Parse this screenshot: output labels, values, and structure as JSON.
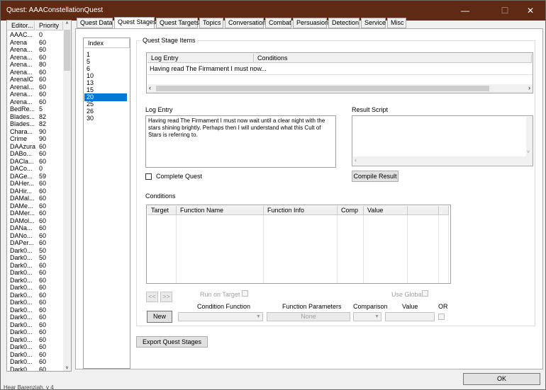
{
  "window": {
    "title": "Quest: AAAConstellationQuest",
    "ok_label": "OK"
  },
  "left_list": {
    "headers": [
      "Editor...",
      "Priority"
    ],
    "rows": [
      [
        "AAAC...",
        "0"
      ],
      [
        "Arena",
        "60"
      ],
      [
        "Arena...",
        "60"
      ],
      [
        "Arena...",
        "60"
      ],
      [
        "Arena...",
        "80"
      ],
      [
        "Arena...",
        "60"
      ],
      [
        "ArenaIC",
        "60"
      ],
      [
        "ArenaI...",
        "60"
      ],
      [
        "Arena...",
        "60"
      ],
      [
        "Arena...",
        "60"
      ],
      [
        "BedRe...",
        "5"
      ],
      [
        "Blades...",
        "82"
      ],
      [
        "Blades...",
        "82"
      ],
      [
        "Chara...",
        "90"
      ],
      [
        "Crime",
        "90"
      ],
      [
        "DAAzura",
        "60"
      ],
      [
        "DABo...",
        "60"
      ],
      [
        "DACla...",
        "60"
      ],
      [
        "DACo...",
        "0"
      ],
      [
        "DAGe...",
        "59"
      ],
      [
        "DAHer...",
        "60"
      ],
      [
        "DAHir...",
        "60"
      ],
      [
        "DAMal...",
        "60"
      ],
      [
        "DAMe...",
        "60"
      ],
      [
        "DAMer...",
        "60"
      ],
      [
        "DAMol...",
        "60"
      ],
      [
        "DANa...",
        "60"
      ],
      [
        "DANo...",
        "60"
      ],
      [
        "DAPer...",
        "60"
      ],
      [
        "Dark0...",
        "50"
      ],
      [
        "Dark0...",
        "50"
      ],
      [
        "Dark0...",
        "60"
      ],
      [
        "Dark0...",
        "60"
      ],
      [
        "Dark0...",
        "60"
      ],
      [
        "Dark0...",
        "60"
      ],
      [
        "Dark0...",
        "60"
      ],
      [
        "Dark0...",
        "60"
      ],
      [
        "Dark0...",
        "60"
      ],
      [
        "Dark0...",
        "60"
      ],
      [
        "Dark0...",
        "60"
      ],
      [
        "Dark0...",
        "60"
      ],
      [
        "Dark0...",
        "60"
      ],
      [
        "Dark0...",
        "60"
      ],
      [
        "Dark0...",
        "60"
      ],
      [
        "Dark0...",
        "60"
      ],
      [
        "Dark0...",
        "60"
      ],
      [
        "Dark0...",
        "60"
      ],
      [
        "Dark0...",
        "60"
      ]
    ]
  },
  "tabs": [
    "Quest Data",
    "Quest Stages",
    "Quest Targets",
    "Topics",
    "Conversation",
    "Combat",
    "Persuasion",
    "Detection",
    "Service",
    "Misc"
  ],
  "index_list": {
    "header": "Index",
    "items": [
      "1",
      "5",
      "6",
      "10",
      "13",
      "15",
      "20",
      "25",
      "26",
      "30"
    ],
    "selected": "20"
  },
  "stage_items": {
    "group_label": "Quest Stage Items",
    "headers": [
      "Log Entry",
      "Conditions"
    ],
    "rows": [
      [
        "Having read The Firmament I must now...",
        ""
      ]
    ]
  },
  "log_entry": {
    "label": "Log Entry",
    "text": "Having read The Firmament I must now wait until a clear night with the stars shining brightly. Perhaps then I will understand what this Cult of Stars is referring to."
  },
  "result_script": {
    "label": "Result Script",
    "compile_label": "Compile Result"
  },
  "complete_quest_label": "Complete Quest",
  "conditions": {
    "label": "Conditions",
    "headers": [
      "Target",
      "Function Name",
      "Function Info",
      "Comp",
      "Value"
    ],
    "nav_prev": "<<",
    "nav_next": ">>",
    "run_on_target_label": "Run on Target",
    "use_global_label": "Use Global",
    "new_label": "New",
    "condition_function_label": "Condition Function",
    "function_parameters_label": "Function Parameters",
    "function_parameters_value": "None",
    "comparison_label": "Comparison",
    "value_label": "Value",
    "or_label": "OR"
  },
  "export_label": "Export Quest Stages",
  "background_text": "Hear Barenziah, v 4"
}
